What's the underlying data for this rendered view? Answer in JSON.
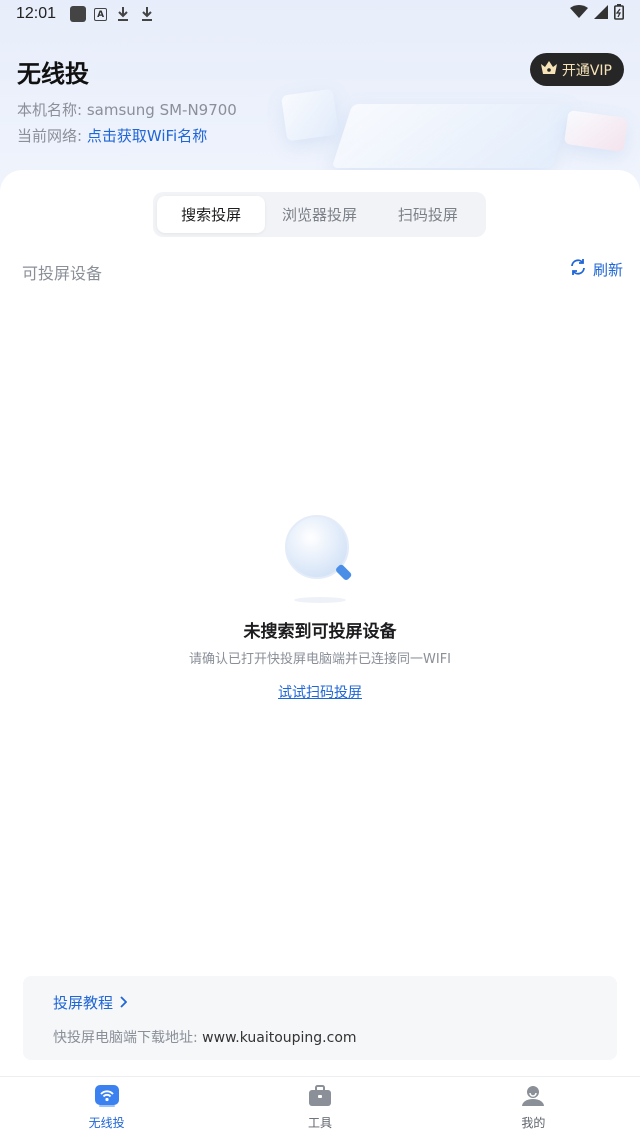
{
  "status_bar": {
    "time": "12:01",
    "icons": [
      "app-square-icon",
      "app-a-icon",
      "download-icon",
      "download-icon",
      "wifi-icon",
      "signal-icon",
      "battery-icon"
    ]
  },
  "header": {
    "title": "无线投",
    "vip_label": "开通VIP",
    "device_label": "本机名称:",
    "device_name": "samsung SM-N9700",
    "network_label": "当前网络:",
    "network_link": "点击获取WiFi名称"
  },
  "tabs": [
    {
      "label": "搜索投屏",
      "active": true
    },
    {
      "label": "浏览器投屏",
      "active": false
    },
    {
      "label": "扫码投屏",
      "active": false
    }
  ],
  "devices": {
    "section_label": "可投屏设备",
    "refresh_label": "刷新"
  },
  "empty_state": {
    "title": "未搜索到可投屏设备",
    "description": "请确认已打开快投屏电脑端并已连接同一WIFI",
    "link": "试试扫码投屏"
  },
  "tutorial": {
    "link": "投屏教程",
    "download_label": "快投屏电脑端下载地址:",
    "download_url": "www.kuaitouping.com"
  },
  "bottom_nav": [
    {
      "label": "无线投",
      "icon": "cast-wifi-icon",
      "active": true
    },
    {
      "label": "工具",
      "icon": "toolbox-icon",
      "active": false
    },
    {
      "label": "我的",
      "icon": "profile-icon",
      "active": false
    }
  ],
  "colors": {
    "accent": "#1f66d6",
    "vip_bg": "#262626",
    "vip_text": "#f6e3b8"
  }
}
